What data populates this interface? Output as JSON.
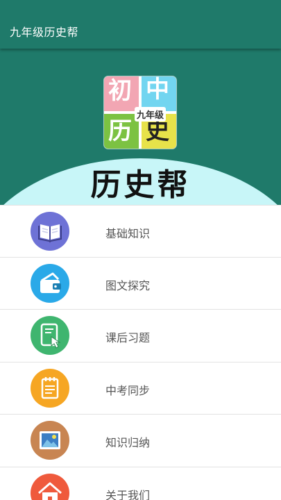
{
  "app": {
    "title": "九年级历史帮"
  },
  "hero": {
    "logo_chars": [
      "初",
      "中",
      "历",
      "史"
    ],
    "logo_grade": "九年级",
    "title": "历史帮"
  },
  "colors": {
    "primary": "#1f7a6a",
    "hero_arc": "#c8f6f8"
  },
  "menu": {
    "items": [
      {
        "label": "基础知识",
        "icon": "book-icon",
        "color": "#6e72d6"
      },
      {
        "label": "图文探究",
        "icon": "wallet-icon",
        "color": "#2aa9e8"
      },
      {
        "label": "课后习题",
        "icon": "tablet-tap-icon",
        "color": "#3fb56f"
      },
      {
        "label": "中考同步",
        "icon": "notepad-icon",
        "color": "#f6a623"
      },
      {
        "label": "知识归纳",
        "icon": "picture-icon",
        "color": "#c88552"
      },
      {
        "label": "关于我们",
        "icon": "home-icon",
        "color": "#ef5a3c"
      }
    ]
  }
}
